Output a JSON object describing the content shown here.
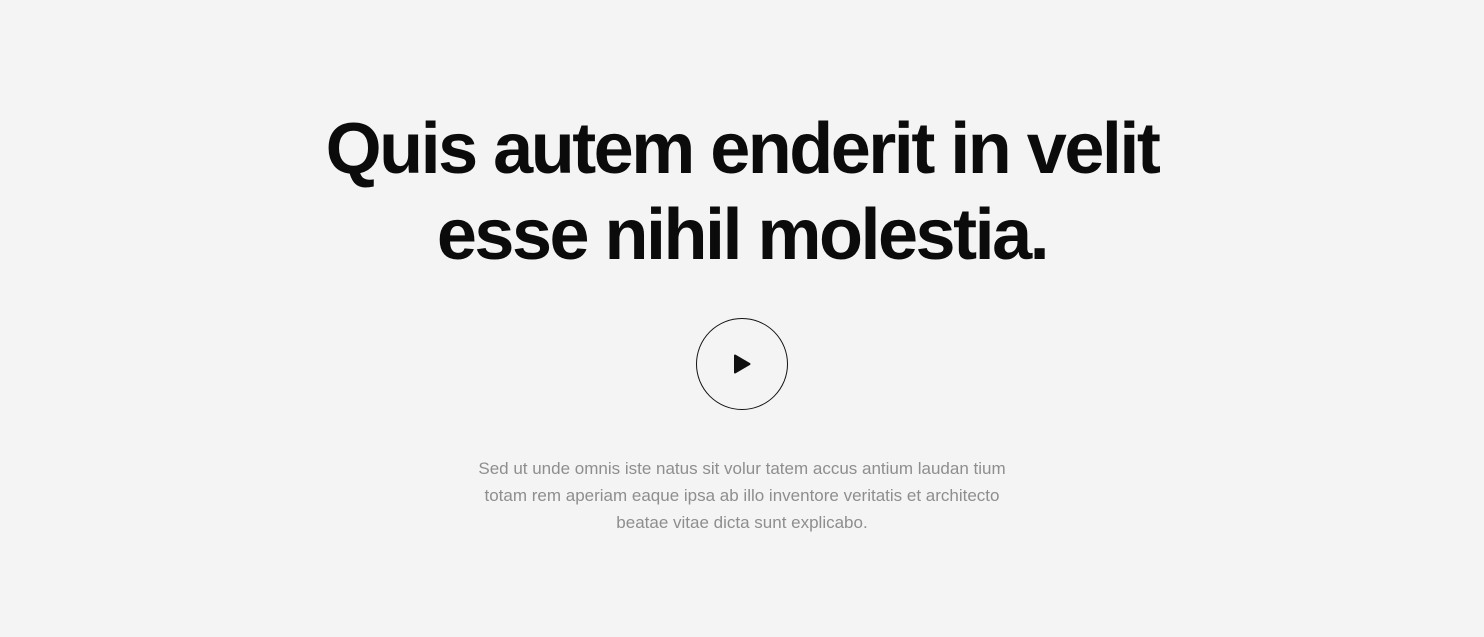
{
  "hero": {
    "title_line_1": "Quis autem enderit in velit",
    "title_line_2": "esse nihil molestia.",
    "play_button_icon": "play-icon",
    "description_line_1": "Sed ut unde omnis iste natus sit volur tatem accus antium laudan tium",
    "description_line_2": "totam rem aperiam eaque ipsa ab illo inventore veritatis et architecto",
    "description_line_3": "beatae vitae dicta sunt explicabo."
  },
  "colors": {
    "background": "#f4f4f4",
    "title": "#0b0b0b",
    "description": "#8e8e8e",
    "play_border": "#111111"
  }
}
